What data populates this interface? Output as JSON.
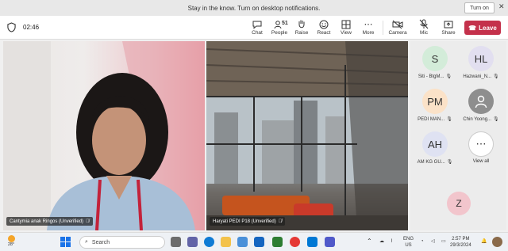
{
  "notification": {
    "message": "Stay in the know. Turn on desktop notifications.",
    "turn_on": "Turn on",
    "close": "✕"
  },
  "meeting": {
    "elapsed": "02:46",
    "participants_count": "51"
  },
  "toolbar": {
    "chat": "Chat",
    "people": "People",
    "raise": "Raise",
    "react": "React",
    "view": "View",
    "more": "More",
    "camera": "Camera",
    "mic": "Mic",
    "share": "Share",
    "leave": "Leave"
  },
  "videos": [
    {
      "name": "Cantymia anak Ringos (Unverified)"
    },
    {
      "name": "Haryati PEDI P18 (Unverified)"
    }
  ],
  "roster": [
    {
      "initials": "S",
      "label": "Siti - BtgM...",
      "color": "#d3ecd9"
    },
    {
      "initials": "HL",
      "label": "Hazwani_N...",
      "color": "#e2dff0"
    },
    {
      "initials": "PM",
      "label": "PEDI MAN...",
      "color": "#fbe2c8"
    },
    {
      "initials": "",
      "label": "Chin Yoong...",
      "color": "#8e8e8e"
    },
    {
      "initials": "AH",
      "label": "AM KG GU...",
      "color": "#dfe2f2"
    },
    {
      "initials": "⋯",
      "label": "View all",
      "color": "#ffffff"
    }
  ],
  "roster_extra": {
    "initials": "Z"
  },
  "taskbar": {
    "weather_temp": "28°",
    "search_placeholder": "Search",
    "lang": "ENG",
    "region": "US",
    "time": "2:57 PM",
    "date": "29/3/2024"
  }
}
